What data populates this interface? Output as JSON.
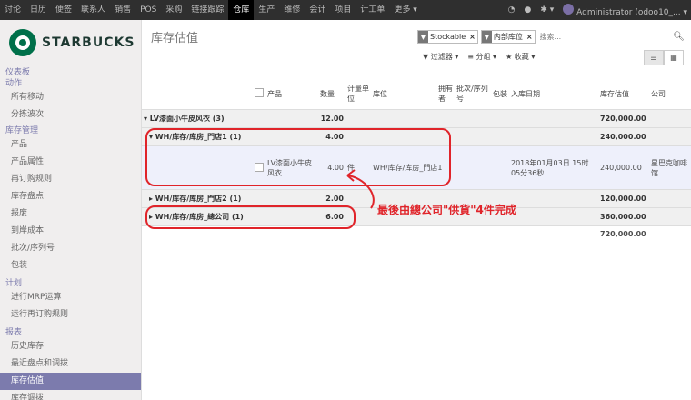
{
  "topbar": {
    "menu": [
      "讨论",
      "日历",
      "便签",
      "联系人",
      "销售",
      "POS",
      "采购",
      "链接跟踪",
      "仓库",
      "生产",
      "维修",
      "会计",
      "项目",
      "计工单",
      "更多 ▾"
    ],
    "active_index": 8,
    "user": "Administrator (odoo10_..."
  },
  "sidebar": {
    "brand": "STARBUCKS",
    "sections": [
      {
        "title": "仪表板",
        "items": []
      },
      {
        "title": "动作",
        "items": [
          "所有移动",
          "分拣波次"
        ]
      },
      {
        "title": "库存管理",
        "items": [
          "产品",
          "产品属性",
          "再订购规则",
          "库存盘点",
          "报废",
          "到岸成本",
          "批次/序列号",
          "包装"
        ]
      },
      {
        "title": "计划",
        "items": [
          "进行MRP运算",
          "运行再订购规则"
        ]
      },
      {
        "title": "报表",
        "items": [
          "历史库存",
          "最近盘点和调拨",
          "库存估值",
          "库存调拨"
        ]
      }
    ],
    "active_item": "库存估值"
  },
  "page": {
    "title": "库存估值",
    "facets": [
      "Stockable",
      "内部库位"
    ],
    "search_placeholder": "搜索...",
    "buttons": [
      "▼ 过滤器 ▾",
      "≡ 分组 ▾",
      "★ 收藏 ▾"
    ]
  },
  "table": {
    "headers": [
      "产品",
      "数量",
      "计量单位",
      "库位",
      "拥有者",
      "批次/序列号",
      "包装",
      "入库日期",
      "库存估值",
      "公司"
    ],
    "group_root": {
      "label": "▾ LV漆面小牛皮风衣 (3)",
      "qty": "12.00",
      "value": "720,000.00"
    },
    "subgroups": [
      {
        "label": "▾ WH/库存/库房_門店1 (1)",
        "qty": "4.00",
        "value": "240,000.00"
      },
      {
        "label": "▸ WH/库存/库房_門店2 (1)",
        "qty": "2.00",
        "value": "120,000.00"
      },
      {
        "label": "▸ WH/库存/库房_總公司 (1)",
        "qty": "6.00",
        "value": "360,000.00"
      }
    ],
    "record": {
      "product": "LV漆面小牛皮风衣",
      "qty": "4.00",
      "uom": "件",
      "location": "WH/库存/库房_門店1",
      "date": "2018年01月03日 15时05分36秒",
      "value": "240,000.00",
      "company": "星巴克咖啡馆"
    },
    "total_value": "720,000.00"
  },
  "annotation": {
    "text": "最後由總公司\"供貨\"4件完成"
  },
  "colors": {
    "accent": "#7c7bad",
    "annotation": "#e0242a",
    "topbar": "#2f2f2f"
  }
}
